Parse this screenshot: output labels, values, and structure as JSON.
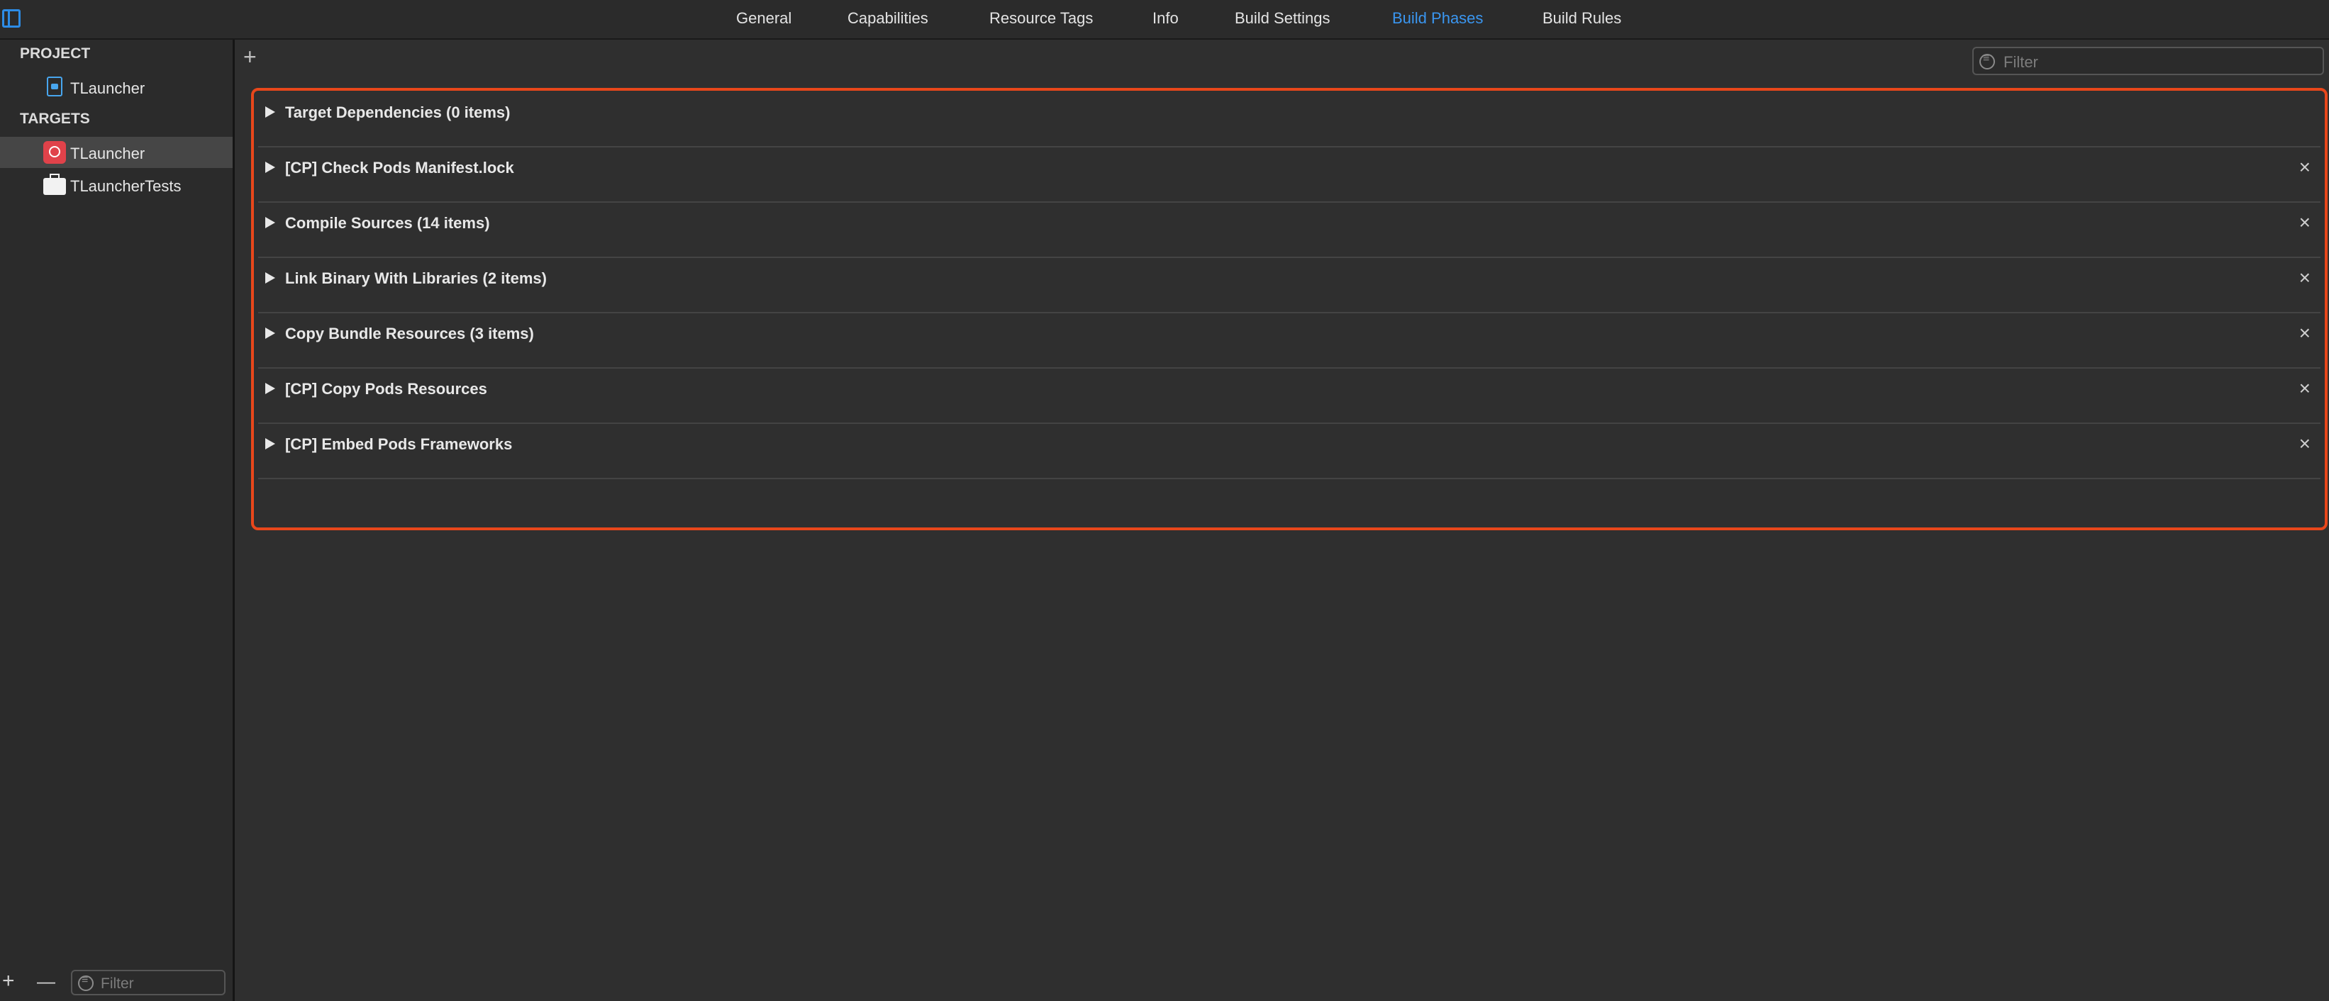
{
  "tabs": [
    {
      "label": "General",
      "active": false
    },
    {
      "label": "Capabilities",
      "active": false
    },
    {
      "label": "Resource Tags",
      "active": false
    },
    {
      "label": "Info",
      "active": false
    },
    {
      "label": "Build Settings",
      "active": false
    },
    {
      "label": "Build Phases",
      "active": true
    },
    {
      "label": "Build Rules",
      "active": false
    }
  ],
  "sidebar": {
    "project_header": "PROJECT",
    "project_item": "TLauncher",
    "targets_header": "TARGETS",
    "targets": [
      {
        "label": "TLauncher",
        "selected": true
      },
      {
        "label": "TLauncherTests",
        "selected": false
      }
    ],
    "filter_placeholder": "Filter",
    "add_symbol": "+",
    "remove_symbol": "—"
  },
  "main": {
    "add_symbol": "+",
    "filter_placeholder": "Filter",
    "phases": [
      {
        "title": "Target Dependencies (0 items)",
        "removable": false
      },
      {
        "title": "[CP] Check Pods Manifest.lock",
        "removable": true
      },
      {
        "title": "Compile Sources (14 items)",
        "removable": true
      },
      {
        "title": "Link Binary With Libraries (2 items)",
        "removable": true
      },
      {
        "title": "Copy Bundle Resources (3 items)",
        "removable": true
      },
      {
        "title": "[CP] Copy Pods Resources",
        "removable": true
      },
      {
        "title": "[CP] Embed Pods Frameworks",
        "removable": true
      }
    ],
    "close_symbol": "×"
  },
  "colors": {
    "accent": "#3a96f0",
    "highlight_border": "#e8471b",
    "background": "#2f2f2f"
  }
}
